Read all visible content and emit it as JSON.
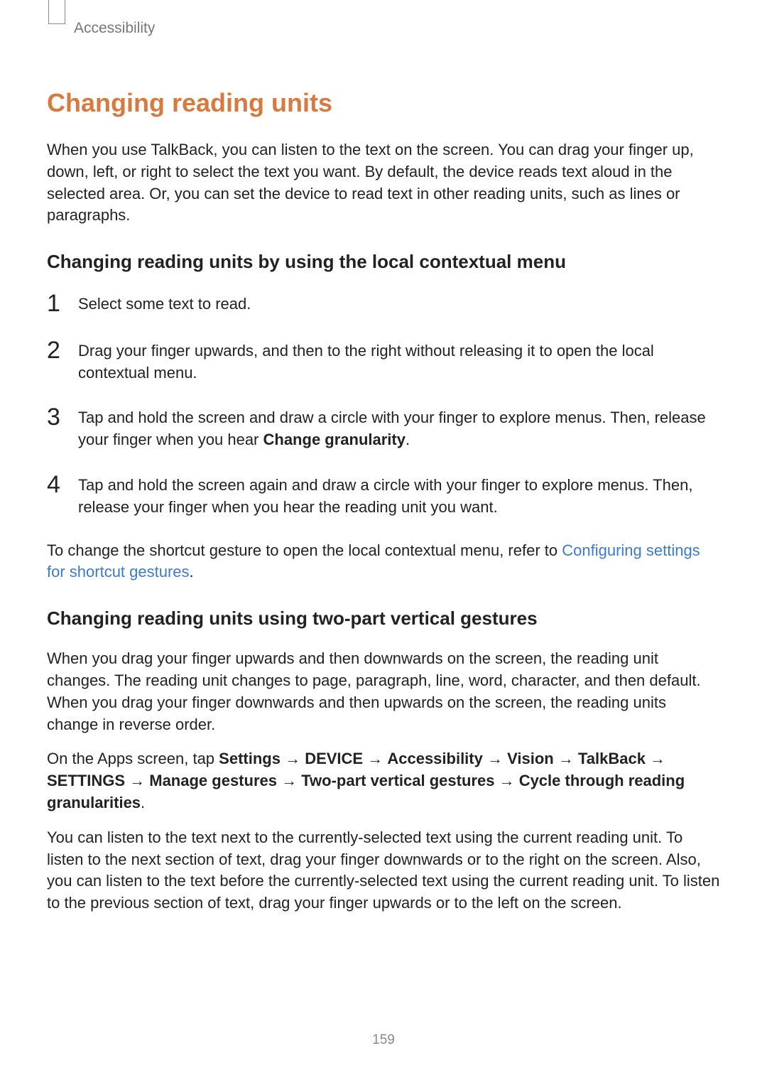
{
  "breadcrumb": "Accessibility",
  "mainHeading": "Changing reading units",
  "intro": "When you use TalkBack, you can listen to the text on the screen. You can drag your finger up, down, left, or right to select the text you want. By default, the device reads text aloud in the selected area. Or, you can set the device to read text in other reading units, such as lines or paragraphs.",
  "sub1": "Changing reading units by using the local contextual menu",
  "steps": {
    "s1": "Select some text to read.",
    "s2": "Drag your finger upwards, and then to the right without releasing it to open the local contextual menu.",
    "s3a": "Tap and hold the screen and draw a circle with your finger to explore menus. Then, release your finger when you hear ",
    "s3b": "Change granularity",
    "s3c": ".",
    "s4": "Tap and hold the screen again and draw a circle with your finger to explore menus. Then, release your finger when you hear the reading unit you want."
  },
  "afterSteps": {
    "pre": "To change the shortcut gesture to open the local contextual menu, refer to ",
    "link": "Configuring settings for shortcut gestures",
    "post": "."
  },
  "sub2": "Changing reading units using two-part vertical gestures",
  "para2": "When you drag your finger upwards and then downwards on the screen, the reading unit changes. The reading unit changes to page, paragraph, line, word, character, and then default. When you drag your finger downwards and then upwards on the screen, the reading units change in reverse order.",
  "nav": {
    "p1": "On the Apps screen, tap ",
    "settings": "Settings",
    "arrow": " → ",
    "device": "DEVICE",
    "accessibility": "Accessibility",
    "vision": "Vision",
    "talkback": "TalkBack",
    "settingsCap": "SETTINGS",
    "manage": "Manage gestures",
    "twopart": "Two-part vertical gestures",
    "cycle": "Cycle through reading granularities",
    "dot": "."
  },
  "para3": "You can listen to the text next to the currently-selected text using the current reading unit. To listen to the next section of text, drag your finger downwards or to the right on the screen. Also, you can listen to the text before the currently-selected text using the current reading unit. To listen to the previous section of text, drag your finger upwards or to the left on the screen.",
  "pageNumber": "159",
  "nums": {
    "n1": "1",
    "n2": "2",
    "n3": "3",
    "n4": "4"
  }
}
